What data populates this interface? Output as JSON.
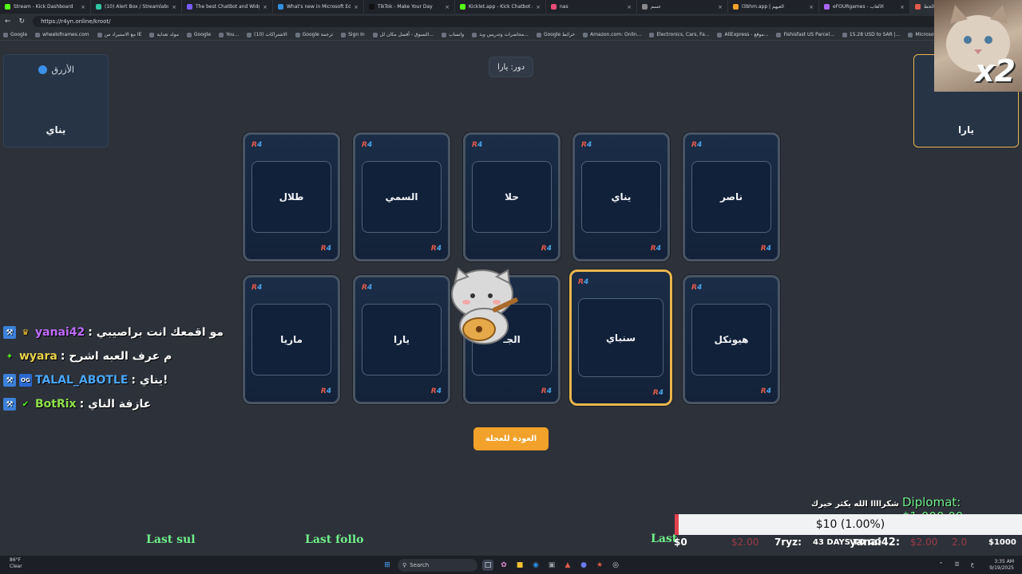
{
  "tabs": [
    {
      "label": "Stream - Kick Dashboard",
      "color": "#53fc18"
    },
    {
      "label": "(10) Alert Box / Streamlabs",
      "color": "#31c3a2"
    },
    {
      "label": "The best ChatBot and Widgets",
      "color": "#7a5cff"
    },
    {
      "label": "What's new in Microsoft Edge",
      "color": "#2f8fe0"
    },
    {
      "label": "TikTok - Make Your Day",
      "color": "#111111"
    },
    {
      "label": "Kicklet.app - Kick Chatbot and",
      "color": "#53fc18"
    },
    {
      "label": "nas",
      "color": "#e84b7a"
    },
    {
      "label": "عسم",
      "color": "#888888"
    },
    {
      "label": "l3bhm.app | العبهم",
      "color": "#f2a12a"
    },
    {
      "label": "eFOURgames - الألعاب",
      "color": "#aa66ff"
    },
    {
      "label": "كروت الحظ",
      "color": "#e25a4a"
    }
  ],
  "url": "https://r4yn.online/kroot/",
  "bookmarks": [
    "Google",
    "wheelofnames.com",
    "مع الاستيراد من IE",
    "مولد تعداية",
    "Google",
    "You...",
    "(10) الاشتراكات",
    "Google ترجمة",
    "Sign In",
    "التسوق - أفضل مكان لل...",
    "واتساب",
    "محاضرات وتدريس وبذ...",
    "Google خرائط",
    "Amazon.com: Onlin...",
    "Electronics, Cars, Fa...",
    "AliExpress - موقع...",
    "Fishisfast US Parcel...",
    "15.28 USD to SAR |...",
    "Microsoft Learning"
  ],
  "left_player": {
    "team": "الأزرق",
    "name": "يناي"
  },
  "right_player": {
    "name": "يارا"
  },
  "turn": "دور: يارا",
  "cards_row1": [
    "طلال",
    "السمي",
    "حلا",
    "يناي",
    "ناصر"
  ],
  "cards_row2": [
    "ماريا",
    "يارا",
    "الجـ",
    "سنباي",
    "هيونكل"
  ],
  "back_button": "العودة للعجلة",
  "chat": [
    {
      "user": "yanai42",
      "message": ": مو اقمعك انت براصيبي",
      "color": "#c06cff"
    },
    {
      "user": "wyara",
      "message": ": م عرف العبه اشرح",
      "color": "#e9d24a"
    },
    {
      "user": "TALAL_ABOTLE",
      "message": ": يناي!",
      "color": "#4aa8ff"
    },
    {
      "user": "BotRix",
      "message": ": عازفة الناي",
      "color": "#8ee04a"
    }
  ],
  "webcam_multiplier": "x2",
  "overlays": {
    "last_sub": "Last sul",
    "last_follow": "Last follo",
    "last_other": "Last",
    "thanks": "شكراااا الله يكثر خيرك",
    "diplomat": "Diplomat: $1,000.00",
    "goal": "$10 (1.00%)",
    "ticker_start": "$0",
    "ticker_faded1": "$2.00",
    "ticker_user1": "7ryz:",
    "ticker_days": "43 DAYS TO GO",
    "ticker_user2": "yanai42:",
    "ticker_faded2": "$2.00",
    "ticker_faded3": "2.0",
    "ticker_end": "$1000"
  },
  "taskbar": {
    "temp": "86°F",
    "weather": "Clear",
    "search": "Search",
    "time": "3:35 AM",
    "date": "9/19/2025"
  }
}
